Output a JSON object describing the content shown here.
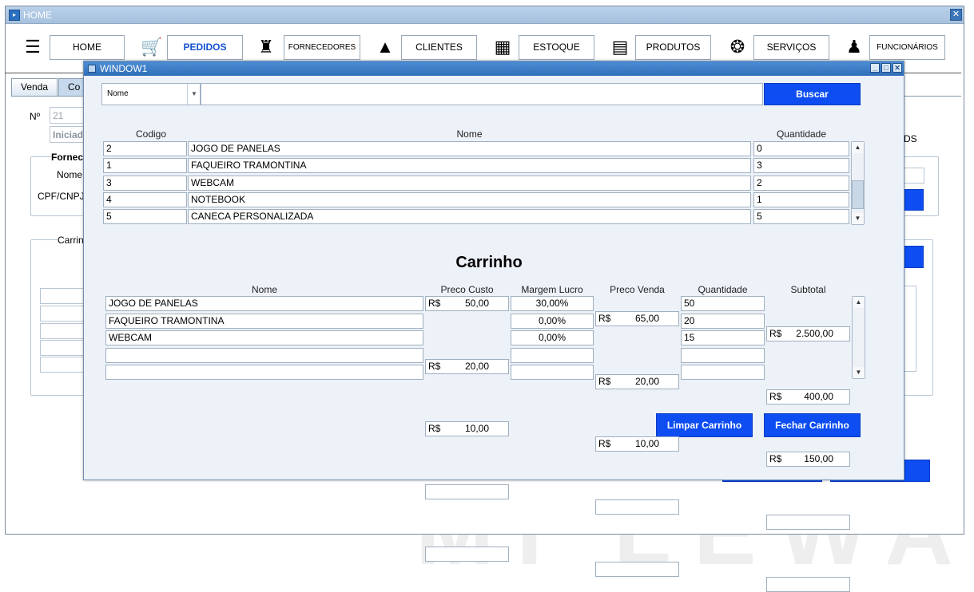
{
  "app": {
    "title": "HOME"
  },
  "nav": [
    {
      "icon": "globe-icon",
      "glyph": "☰",
      "label": "HOME",
      "active": false,
      "small": false
    },
    {
      "icon": "cart-icon",
      "glyph": "🛒",
      "label": "PEDIDOS",
      "active": true,
      "small": false
    },
    {
      "icon": "supplier-icon",
      "glyph": "♜",
      "label": "FORNECEDORES",
      "active": false,
      "small": true
    },
    {
      "icon": "person-icon",
      "glyph": "▲",
      "label": "CLIENTES",
      "active": false,
      "small": false
    },
    {
      "icon": "warehouse-icon",
      "glyph": "▦",
      "label": "ESTOQUE",
      "active": false,
      "small": false
    },
    {
      "icon": "products-icon",
      "glyph": "▤",
      "label": "PRODUTOS",
      "active": false,
      "small": false
    },
    {
      "icon": "services-icon",
      "glyph": "❂",
      "label": "SERVIÇOS",
      "active": false,
      "small": false
    },
    {
      "icon": "employees-icon",
      "glyph": "♟",
      "label": "FUNCIONÁRIOS",
      "active": false,
      "small": true
    }
  ],
  "background": {
    "tabs": [
      "Venda",
      "Co"
    ],
    "numero_label": "Nº",
    "numero_value": "21",
    "status_value": "Iniciad",
    "fornecedor_group": "Fornec",
    "nome_label": "Nome",
    "cpf_label": "CPF/CNPJ",
    "carrinho_group": "Carrin",
    "right_fragment": "DS"
  },
  "window": {
    "title": "WINDOW1",
    "search": {
      "selected": "Nome",
      "value": "",
      "button": "Buscar"
    },
    "products_table": {
      "headers": [
        "Codigo",
        "Nome",
        "Quantidade"
      ],
      "rows": [
        {
          "codigo": "2",
          "nome": "JOGO DE PANELAS",
          "quantidade": "0"
        },
        {
          "codigo": "1",
          "nome": "FAQUEIRO TRAMONTINA",
          "quantidade": "3"
        },
        {
          "codigo": "3",
          "nome": "WEBCAM",
          "quantidade": "2"
        },
        {
          "codigo": "4",
          "nome": "NOTEBOOK",
          "quantidade": "1"
        },
        {
          "codigo": "5",
          "nome": "CANECA PERSONALIZADA",
          "quantidade": "5"
        }
      ]
    },
    "cart": {
      "title": "Carrinho",
      "headers": [
        "Nome",
        "Preco Custo",
        "Margem Lucro",
        "Preco Venda",
        "Quantidade",
        "Subtotal"
      ],
      "currency": "R$",
      "rows": [
        {
          "nome": "JOGO DE PANELAS",
          "custo": "50,00",
          "margem": "30,00%",
          "venda": "65,00",
          "quantidade": "50",
          "subtotal": "2.500,00"
        },
        {
          "nome": "FAQUEIRO TRAMONTINA",
          "custo": "20,00",
          "margem": "0,00%",
          "venda": "20,00",
          "quantidade": "20",
          "subtotal": "400,00"
        },
        {
          "nome": "WEBCAM",
          "custo": "10,00",
          "margem": "0,00%",
          "venda": "10,00",
          "quantidade": "15",
          "subtotal": "150,00"
        }
      ],
      "empty_rows": 2,
      "limpar_button": "Limpar Carrinho",
      "fechar_button": "Fechar Carrinho"
    }
  },
  "colors": {
    "accent": "#0d4df2",
    "active_nav": "#1550d2"
  }
}
